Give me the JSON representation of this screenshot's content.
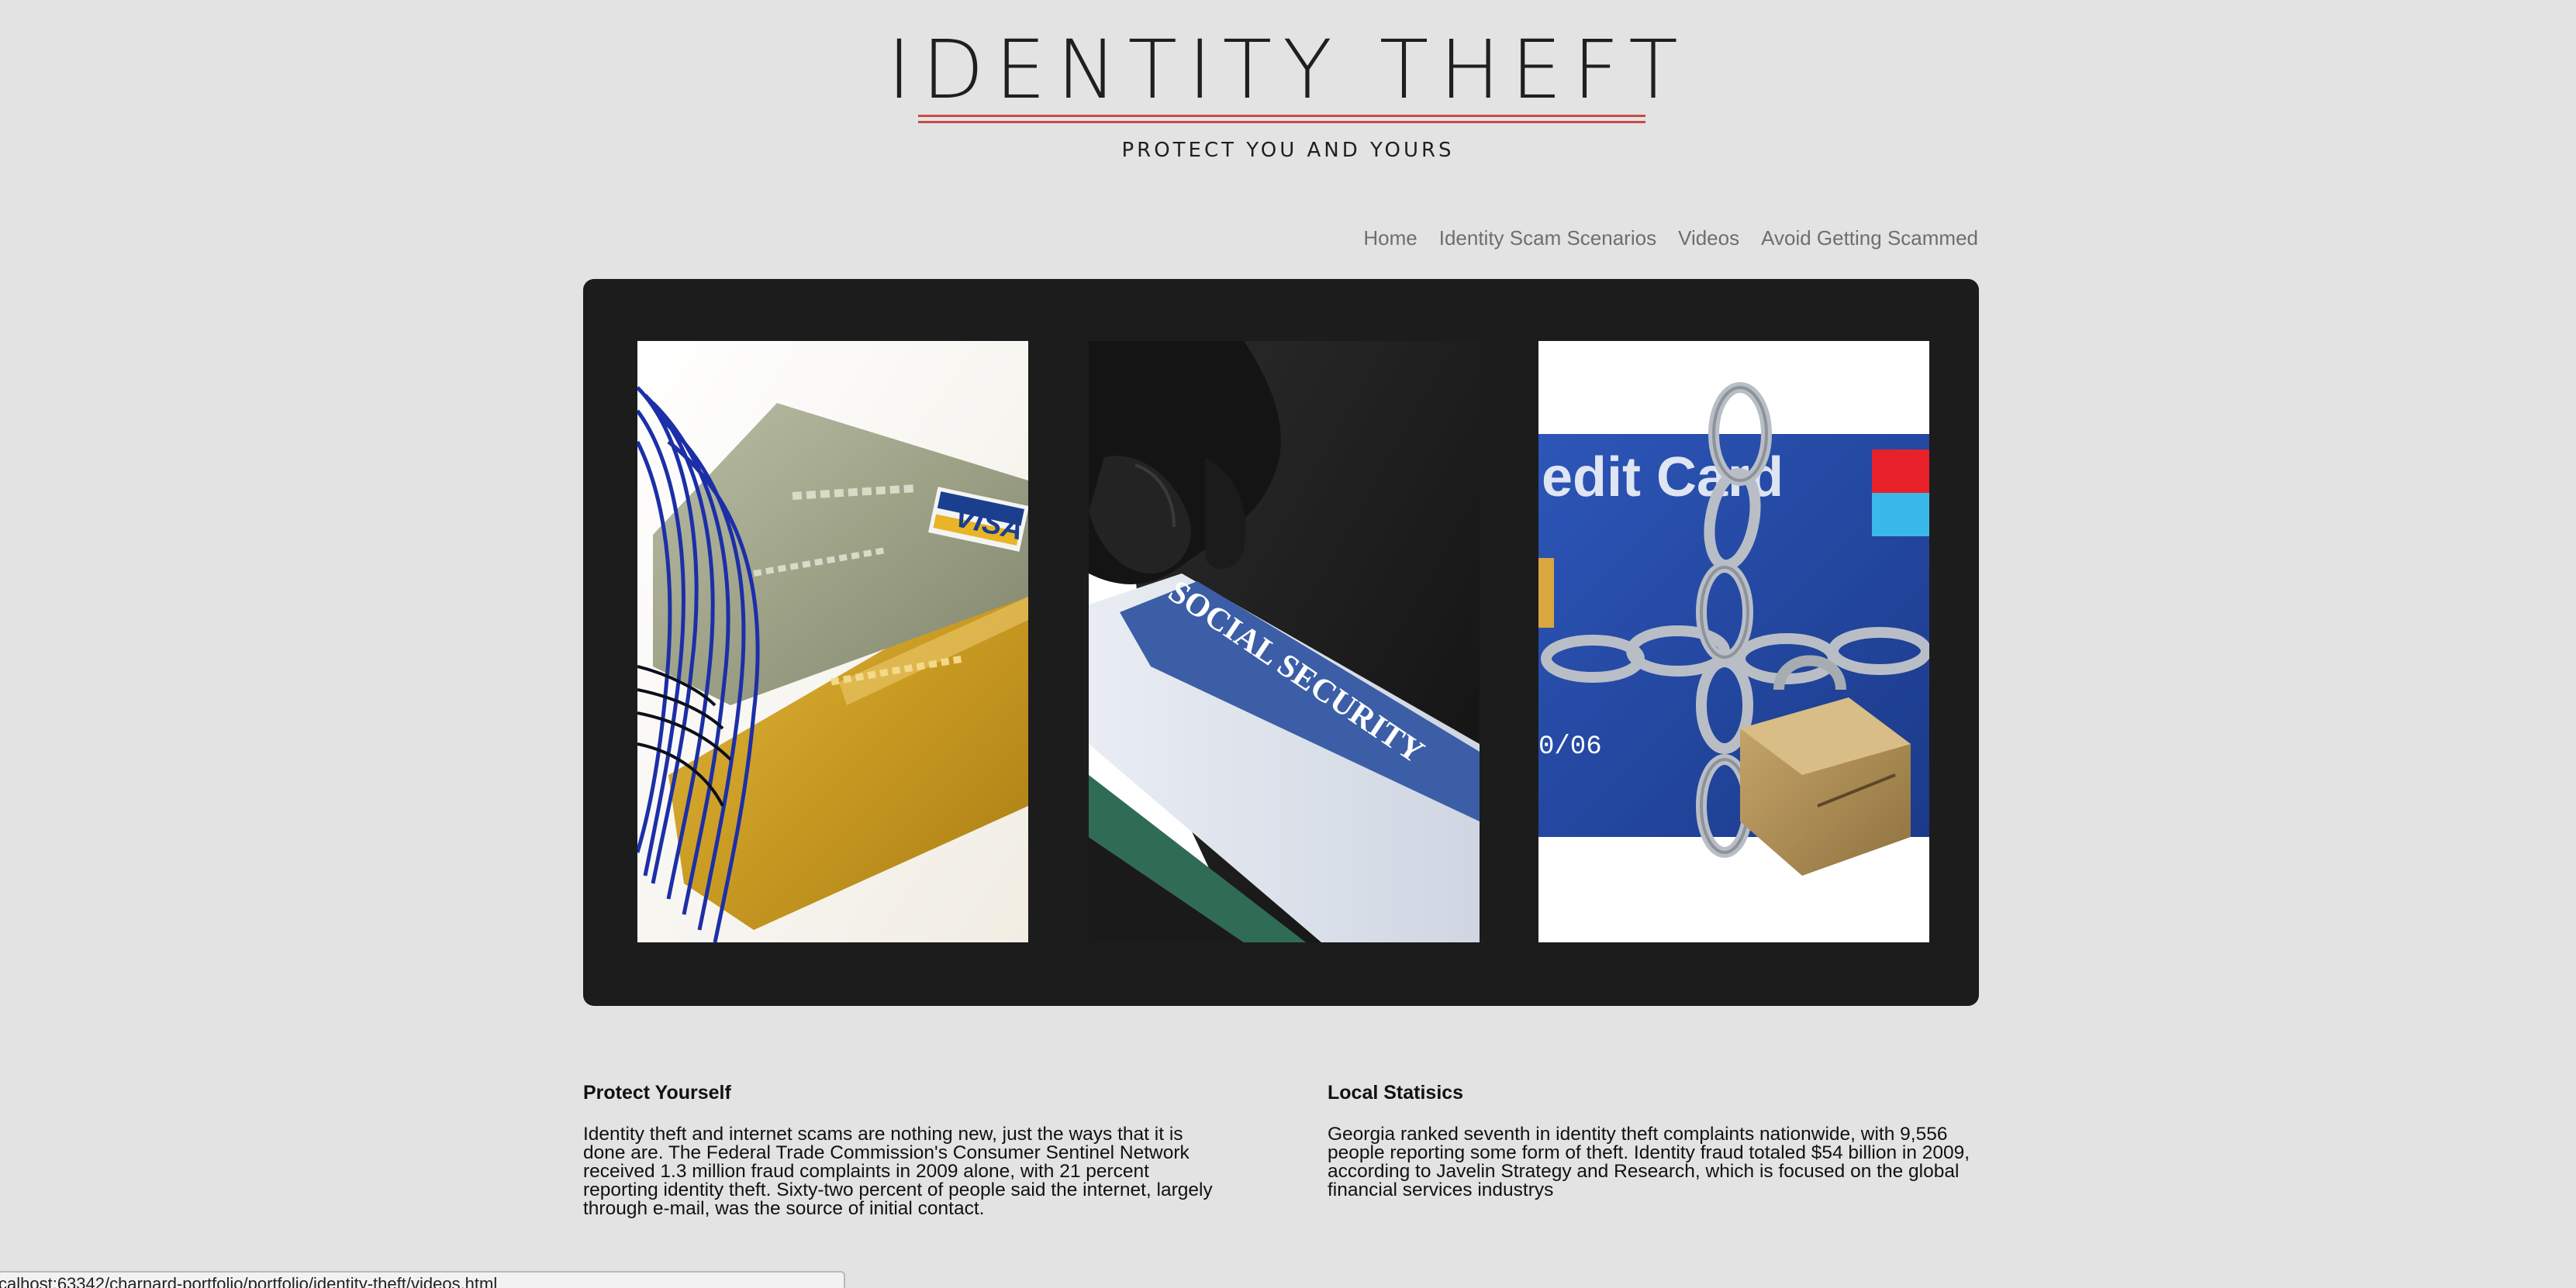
{
  "header": {
    "title": "IDENTITY THEFT",
    "tagline": "PROTECT YOU AND YOURS",
    "accent_color": "#c94a4a"
  },
  "nav": {
    "items": [
      {
        "label": "Home"
      },
      {
        "label": "Identity Scam Scenarios"
      },
      {
        "label": "Videos"
      },
      {
        "label": "Avoid Getting Scammed"
      }
    ]
  },
  "gallery": {
    "background": "#1c1c1c",
    "images": [
      {
        "name": "credit-cards-fingerprint-image",
        "card_text": "VISA"
      },
      {
        "name": "social-security-card-theft-image",
        "card_text": "SOCIAL SECURITY"
      },
      {
        "name": "locked-credit-card-image",
        "card_text": "edit Card",
        "expiry_text": "0/06"
      }
    ]
  },
  "sections": [
    {
      "heading": "Protect Yourself",
      "body": "Identity theft and internet scams are nothing new, just the ways that it is done are. The Federal Trade Commission's Consumer Sentinel Network received 1.3 million fraud complaints  in 2009 alone, with 21 percent reporting identity theft. Sixty-two percent of people said the internet, largely through e-mail, was the source of initial contact."
    },
    {
      "heading": "Local Statisics",
      "body": "Georgia ranked seventh in identity theft complaints nationwide, with 9,556 people reporting some form of theft. Identity fraud totaled $54 billion in 2009, according to Javelin Strategy and Research, which is focused on the global financial services industrys"
    }
  ],
  "status_bar": {
    "url": "calhost:63342/charnard-portfolio/portfolio/identity-theft/videos.html"
  }
}
